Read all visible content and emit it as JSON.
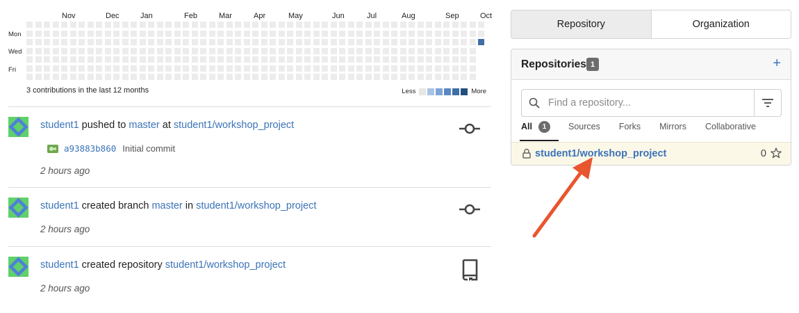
{
  "heatmap": {
    "months": [
      "Nov",
      "Dec",
      "Jan",
      "Feb",
      "Mar",
      "Apr",
      "May",
      "Jun",
      "Jul",
      "Aug",
      "Sep",
      "Oct"
    ],
    "day_labels": [
      "Mon",
      "Wed",
      "Fri"
    ],
    "summary": "3 contributions in the last 12 months",
    "legend_less": "Less",
    "legend_more": "More",
    "legend_colors": [
      "#e6e6e6",
      "#a9c3e4",
      "#7ea5d6",
      "#5a88c2",
      "#3e6ea5",
      "#234f80"
    ],
    "empty_color": "#ececec",
    "active_color": "#3e6ea5"
  },
  "feed": [
    {
      "user": "student1",
      "action": "pushed to",
      "ref": "master",
      "connector": "at",
      "repo": "student1/workshop_project",
      "commit": {
        "sha": "a93883b860",
        "message": "Initial commit"
      },
      "time": "2 hours ago",
      "icon": "commit-icon"
    },
    {
      "user": "student1",
      "action": "created branch",
      "ref": "master",
      "connector": "in",
      "repo": "student1/workshop_project",
      "time": "2 hours ago",
      "icon": "commit-icon"
    },
    {
      "user": "student1",
      "action": "created repository",
      "repo": "student1/workshop_project",
      "time": "2 hours ago",
      "icon": "repo-icon"
    }
  ],
  "right_panel": {
    "tabs": [
      "Repository",
      "Organization"
    ],
    "repos_title": "Repositories",
    "repos_count": "1",
    "add_label": "+",
    "search_placeholder": "Find a repository...",
    "subtabs": [
      "All",
      "Sources",
      "Forks",
      "Mirrors",
      "Collaborative"
    ],
    "all_count": "1",
    "repo": {
      "name": "student1/workshop_project",
      "stars": "0"
    }
  },
  "colors": {
    "link": "#3b73b8",
    "highlight_row": "#fbf8e8",
    "arrow": "#e8552e"
  }
}
